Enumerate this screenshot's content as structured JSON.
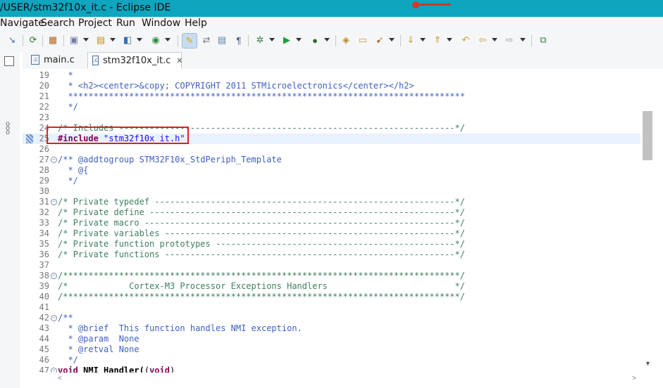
{
  "window": {
    "title": "/USER/stm32f10x_it.c - Eclipse IDE"
  },
  "menu": [
    "Navigate",
    "Search",
    "Project",
    "Run",
    "Window",
    "Help"
  ],
  "tabs": [
    {
      "label": "main.c",
      "active": false
    },
    {
      "label": "stm32f10x_it.c",
      "active": true,
      "close": "✕"
    }
  ],
  "editor": {
    "lines": [
      {
        "n": "19",
        "text": "  *"
      },
      {
        "n": "20",
        "text": "  * <h2><center>&copy; COPYRIGHT 2011 STMicroelectronics</center></h2>"
      },
      {
        "n": "21",
        "text": "  ******************************************************************************"
      },
      {
        "n": "22",
        "text": "  */"
      },
      {
        "n": "23",
        "text": ""
      },
      {
        "n": "24",
        "text": "/* Includes ------------------------------------------------------------------*/"
      },
      {
        "n": "25",
        "text": "#include \"stm32f10x_it.h\""
      },
      {
        "n": "26",
        "text": ""
      },
      {
        "n": "27",
        "text": "/** @addtogroup STM32F10x_StdPeriph_Template"
      },
      {
        "n": "28",
        "text": "  * @{"
      },
      {
        "n": "29",
        "text": "  */"
      },
      {
        "n": "30",
        "text": ""
      },
      {
        "n": "31",
        "text": "/* Private typedef -----------------------------------------------------------*/"
      },
      {
        "n": "32",
        "text": "/* Private define ------------------------------------------------------------*/"
      },
      {
        "n": "33",
        "text": "/* Private macro -------------------------------------------------------------*/"
      },
      {
        "n": "34",
        "text": "/* Private variables ---------------------------------------------------------*/"
      },
      {
        "n": "35",
        "text": "/* Private function prototypes -----------------------------------------------*/"
      },
      {
        "n": "36",
        "text": "/* Private functions ---------------------------------------------------------*/"
      },
      {
        "n": "37",
        "text": ""
      },
      {
        "n": "38",
        "text": "/******************************************************************************/"
      },
      {
        "n": "39",
        "text": "/*            Cortex-M3 Processor Exceptions Handlers                         */"
      },
      {
        "n": "40",
        "text": "/******************************************************************************/"
      },
      {
        "n": "41",
        "text": ""
      },
      {
        "n": "42",
        "text": "/**"
      },
      {
        "n": "43",
        "text": "  * @brief  This function handles NMI exception."
      },
      {
        "n": "44",
        "text": "  * @param  None"
      },
      {
        "n": "45",
        "text": "  * @retval None"
      },
      {
        "n": "46",
        "text": "  */"
      },
      {
        "n": "47",
        "text": "void NMI_Handler(void)"
      }
    ]
  }
}
